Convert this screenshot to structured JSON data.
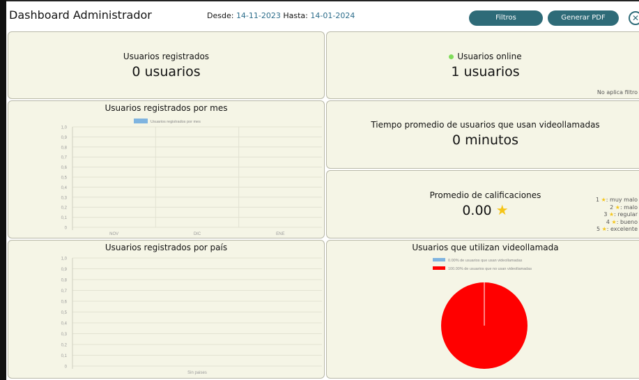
{
  "header": {
    "title": "Dashboard Administrador",
    "desde_label": "Desde:",
    "desde_value": "14-11-2023",
    "hasta_label": "Hasta:",
    "hasta_value": "14-01-2024",
    "filtros_label": "Filtros",
    "pdf_label": "Generar PDF",
    "close_icon": "close-circle-icon"
  },
  "cards": {
    "users_title": "Usuarios registrados",
    "users_value": "0 usuarios",
    "online_title": "Usuarios online",
    "online_value": "1 usuarios",
    "online_note": "No aplica filtro",
    "time_title": "Tiempo promedio de usuarios que usan videollamadas",
    "time_value": "0 minutos",
    "rating_title": "Promedio de calificaciones",
    "rating_value": "0.00",
    "rating_scale": [
      {
        "num": "1",
        "label": ": muy malo"
      },
      {
        "num": "2",
        "label": ": malo"
      },
      {
        "num": "3",
        "label": ": regular"
      },
      {
        "num": "4",
        "label": ": bueno"
      },
      {
        "num": "5",
        "label": ": excelente"
      }
    ]
  },
  "colors": {
    "accent": "#2e6b78",
    "panel_bg": "#f5f5e6",
    "online_dot": "#7fdc5a",
    "star": "#f5c518",
    "bar_legend": "#7fb4e0",
    "red": "#ff0000"
  },
  "chart_data": [
    {
      "type": "bar",
      "title": "Usuarios registrados por mes",
      "categories": [
        "NOV",
        "DIC",
        "ENE"
      ],
      "series": [
        {
          "name": "Usuarios registrados por mes",
          "values": [
            0,
            0,
            0
          ]
        }
      ],
      "yticks": [
        "0",
        "0,1",
        "0,2",
        "0,3",
        "0,4",
        "0,5",
        "0,6",
        "0,7",
        "0,8",
        "0,9",
        "1,0"
      ],
      "ylim": [
        0,
        1
      ],
      "grid": true,
      "legend": "top"
    },
    {
      "type": "bar",
      "title": "Usuarios registrados por país",
      "categories": [
        "Sin paises"
      ],
      "series": [
        {
          "values": [
            0
          ]
        }
      ],
      "yticks": [
        "0",
        "0,1",
        "0,2",
        "0,3",
        "0,4",
        "0,5",
        "0,6",
        "0,7",
        "0,8",
        "0,9",
        "1,0"
      ],
      "ylim": [
        0,
        1
      ],
      "grid": true
    },
    {
      "type": "pie",
      "title": "Usuarios que utilizan videollamada",
      "slices": [
        {
          "label": "0.00% de usuarios que usan videollamadas",
          "value": 0,
          "color": "#7fb4e0"
        },
        {
          "label": "100.00% de usuarios que no usan videollamadas",
          "value": 100,
          "color": "#ff0000"
        }
      ],
      "legend": "top"
    }
  ]
}
